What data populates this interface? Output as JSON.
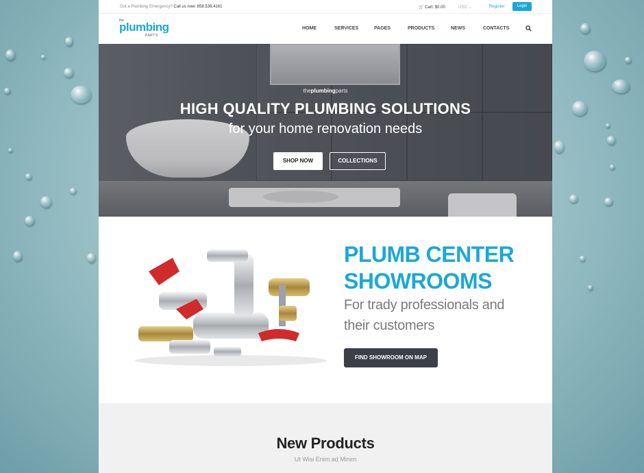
{
  "topbar": {
    "emergency_text": "Got a Plumbing Emergency?",
    "call_text": "Call us now: 858.536.4161",
    "cart": "Cart: $0.00",
    "currency": "USD",
    "register": "Register",
    "login": "Login"
  },
  "logo": {
    "the": "the",
    "word": "plumbing",
    "parts": "PARTS"
  },
  "nav": {
    "items": [
      {
        "label": "HOME"
      },
      {
        "label": "SERVICES"
      },
      {
        "label": "PAGES"
      },
      {
        "label": "PRODUCTS"
      },
      {
        "label": "NEWS"
      },
      {
        "label": "CONTACTS"
      }
    ],
    "search_icon": "search-icon"
  },
  "hero": {
    "brand_prefix": "the",
    "brand_bold": "plumbing",
    "brand_suffix": "parts",
    "title": "HIGH QUALITY PLUMBING SOLUTIONS",
    "subtitle": "for your home renovation needs",
    "shop_now": "SHOP NOW",
    "collections": "COLLECTIONS"
  },
  "showrooms": {
    "title_line1": "PLUMB CENTER",
    "title_line2": "SHOWROOMS",
    "subtitle_line1": "For trady professionals and",
    "subtitle_line2": "their customers",
    "button": "FIND SHOWROOM ON MAP"
  },
  "new_products": {
    "title": "New Products",
    "subtitle": "Ut Wisi Enim ad Minim"
  },
  "colors": {
    "accent": "#1aa8d8",
    "dark_button": "#3b3f48",
    "section_bg": "#f1f1f1"
  }
}
